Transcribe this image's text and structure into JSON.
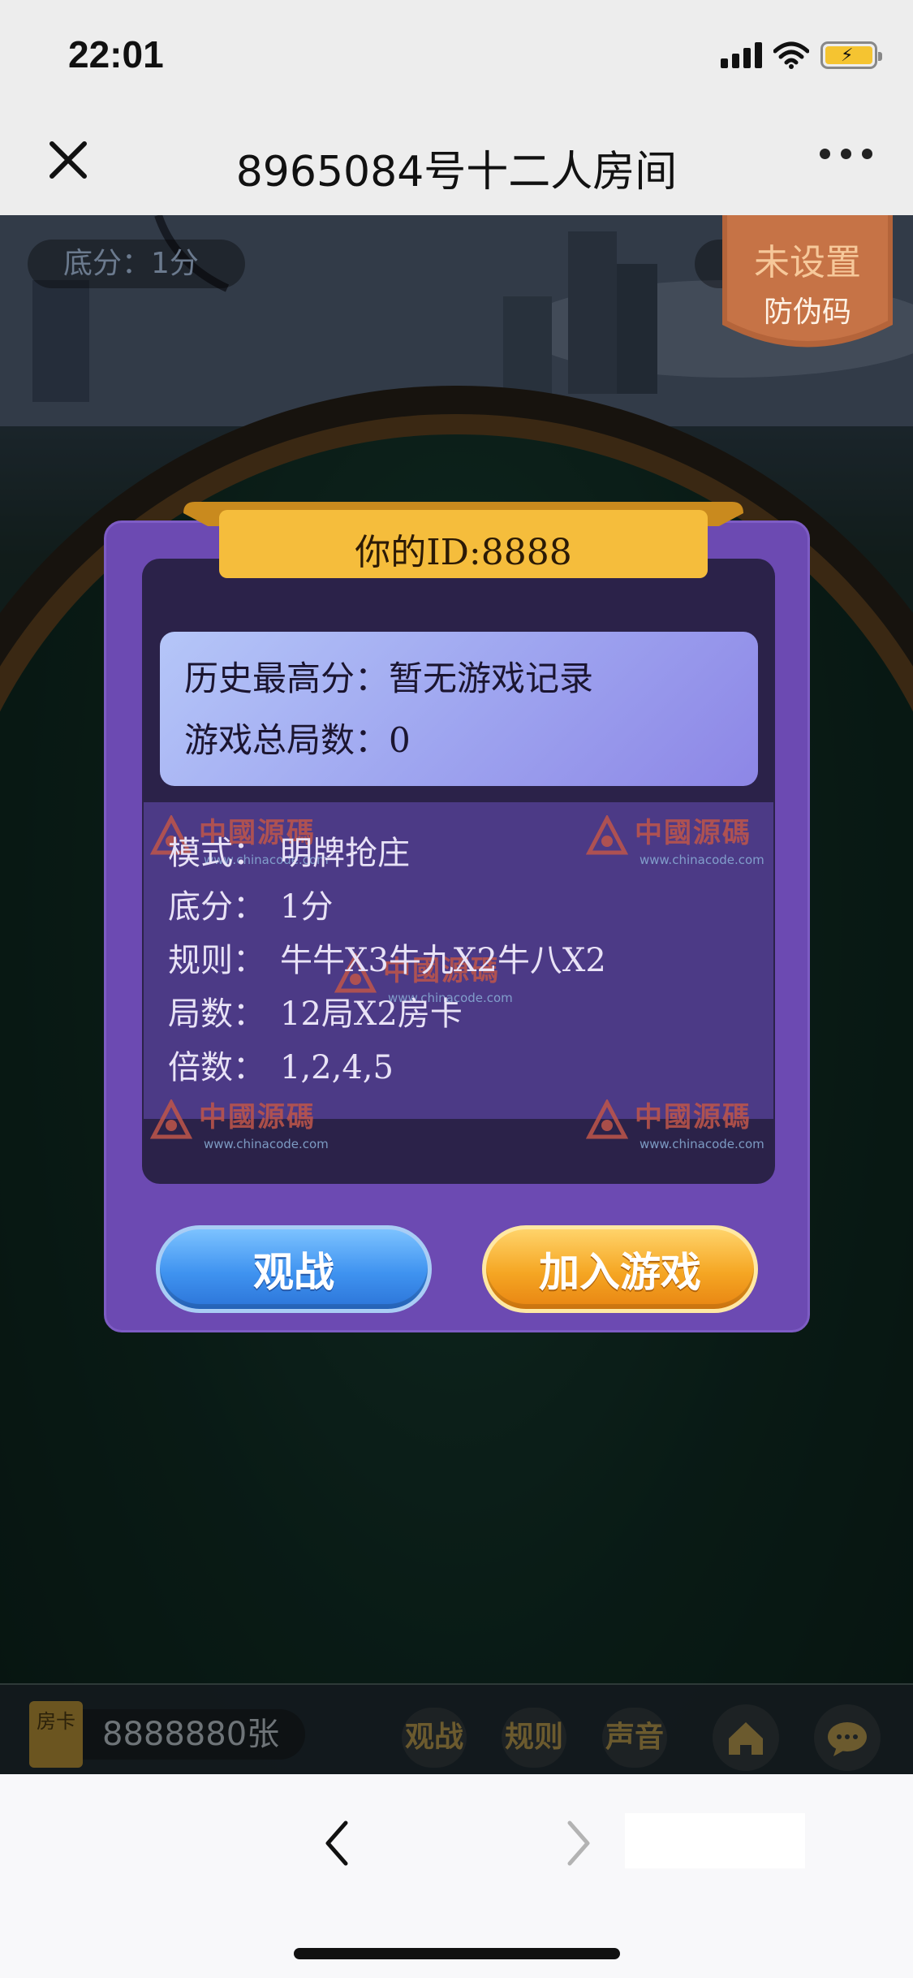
{
  "status_bar": {
    "time": "22:01",
    "icons": [
      "signal-icon",
      "wifi-icon",
      "battery-charging-icon"
    ],
    "battery_color": "#f5c431"
  },
  "nav": {
    "title": "8965084号十二人房间",
    "close_icon": "close-icon",
    "more_icon": "more-icon"
  },
  "game": {
    "base_score": "底分：1分",
    "anti_fake_badge": {
      "line1": "未设置",
      "line2": "防伪码"
    }
  },
  "dialog": {
    "title": "你的ID:8888",
    "history": {
      "high_score": "历史最高分：暂无游戏记录",
      "total_rounds": "游戏总局数：0"
    },
    "rules": [
      {
        "key": "模式：",
        "value": "明牌抢庄"
      },
      {
        "key": "底分：",
        "value": "1分"
      },
      {
        "key": "规则：",
        "value": "牛牛X3牛九X2牛八X2"
      },
      {
        "key": "局数：",
        "value": "12局X2房卡"
      },
      {
        "key": "倍数：",
        "value": "1,2,4,5"
      }
    ],
    "watermark": {
      "text": "中國源碼",
      "url": "www.chinacode.com"
    },
    "watch_button": "观战",
    "join_button": "加入游戏"
  },
  "bottom_bar": {
    "card_label": "房卡",
    "card_count": "8888880张",
    "watch": "观战",
    "rules": "规则",
    "sound": "声音",
    "home_icon": "home-icon",
    "chat_icon": "chat-icon"
  },
  "browser": {
    "back_icon": "chevron-left-icon",
    "forward_icon": "chevron-right-icon"
  },
  "colors": {
    "dialog": "#6c4ab2",
    "ribbon": "#f5bd3c",
    "watch_button": "#3f93f0",
    "join_button": "#f5a623"
  }
}
